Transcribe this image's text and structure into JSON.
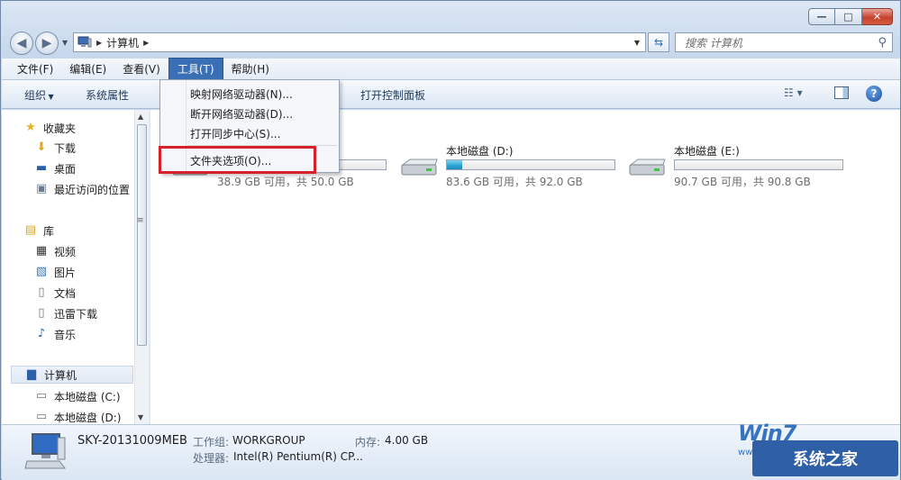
{
  "window": {
    "caption_min": "—",
    "caption_max": "□",
    "caption_close": "✕"
  },
  "address": {
    "crumbs": [
      "计算机"
    ],
    "search_placeholder": "搜索 计算机"
  },
  "menubar": {
    "items": [
      "文件(F)",
      "编辑(E)",
      "查看(V)",
      "工具(T)",
      "帮助(H)"
    ]
  },
  "toolbar": {
    "organize": "组织",
    "system_properties": "系统属性",
    "control_panel": "打开控制面板"
  },
  "tools_menu": {
    "items": [
      "映射网络驱动器(N)...",
      "断开网络驱动器(D)...",
      "打开同步中心(S)...",
      "文件夹选项(O)..."
    ]
  },
  "navpane": {
    "favorites": "收藏夹",
    "downloads": "下载",
    "desktop": "桌面",
    "recent": "最近访问的位置",
    "libraries": "库",
    "videos": "视频",
    "pictures": "图片",
    "documents": "文档",
    "xunlei": "迅雷下载",
    "music": "音乐",
    "computer": "计算机",
    "disk_c": "本地磁盘 (C:)",
    "disk_d": "本地磁盘 (D:)"
  },
  "drives": [
    {
      "name": "",
      "free": "38.9 GB 可用，共 50.0 GB",
      "used_fraction": 0.22
    },
    {
      "name": "本地磁盘 (D:)",
      "free": "83.6 GB 可用，共 92.0 GB",
      "used_fraction": 0.09
    },
    {
      "name": "本地磁盘 (E:)",
      "free": "90.7 GB 可用，共 90.8 GB",
      "used_fraction": 0.0
    }
  ],
  "details": {
    "computer_name": "SKY-20131009MEB",
    "workgroup_label": "工作组:",
    "workgroup": "WORKGROUP",
    "memory_label": "内存:",
    "memory": "4.00 GB",
    "cpu_label": "处理器:",
    "cpu": "Intel(R) Pentium(R) CP..."
  },
  "watermark": {
    "logo": "Win7",
    "brand": "系统之家",
    "site": "www.winwin7.com"
  },
  "colors": {
    "menu_active": "#3a6fb5",
    "highlight_box": "#d6212a",
    "drive_fill": "#2aa2d2"
  }
}
